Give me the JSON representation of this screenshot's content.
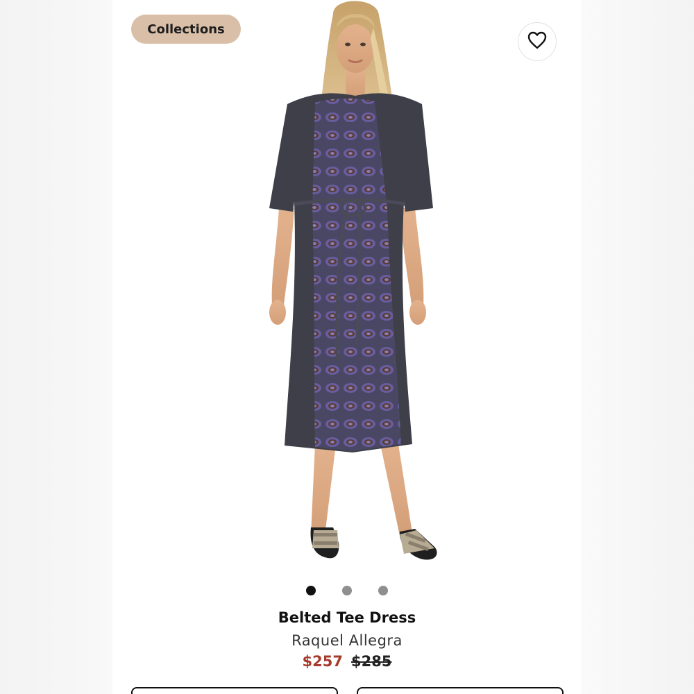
{
  "header": {
    "collections_label": "Collections",
    "favorite_icon": "heart-outline-icon"
  },
  "gallery": {
    "image_count": 3,
    "active_index": 0
  },
  "product": {
    "title": "Belted Tee Dress",
    "brand": "Raquel Allegra",
    "sale_price": "$257",
    "original_price": "$285"
  },
  "colors": {
    "pill_bg": "#d9bfa8",
    "sale_price": "#a63a2c",
    "dot_active": "#111111",
    "dot_inactive": "#8f8f8f"
  }
}
